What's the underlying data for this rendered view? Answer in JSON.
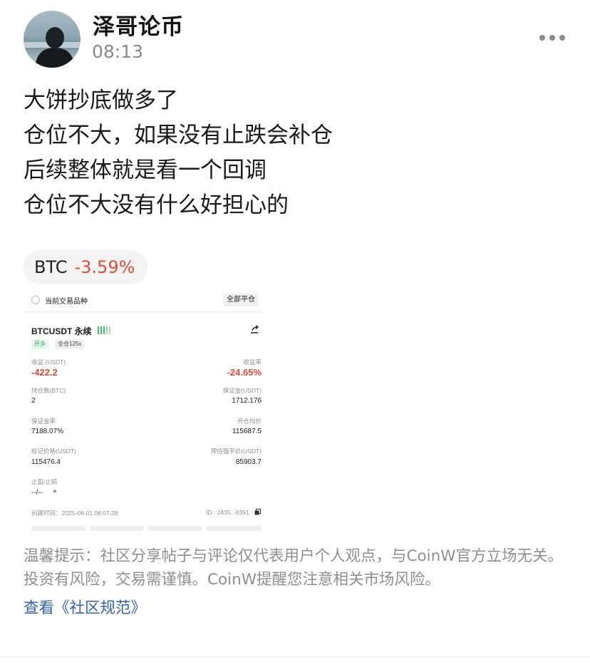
{
  "post": {
    "author": "泽哥论币",
    "time": "08:13",
    "lines": [
      "大饼抄底做多了",
      "仓位不大，如果没有止跌会补仓",
      "后续整体就是看一个回调",
      "仓位不大没有什么好担心的"
    ]
  },
  "ticker": {
    "symbol": "BTC",
    "change": "-3.59%",
    "change_color": "#e04f39"
  },
  "position_card": {
    "current_label": "当前交易品种",
    "close_all": "全部平仓",
    "pair": "BTCUSDT 永续",
    "side": "开多",
    "margin_mode": "全仓125x",
    "pnl_label": "收益 (USDT)",
    "pnl_value": "-422.2",
    "roi_label": "收益率",
    "roi_value": "-24.65%",
    "size_label": "持仓数(BTC)",
    "size_value": "2",
    "margin_label": "保证金(USDT)",
    "margin_value": "1712.176",
    "margin_ratio_label": "保证金率",
    "margin_ratio_value": "7188.07%",
    "entry_label": "开仓均价",
    "entry_value": "115687.5",
    "mark_label": "标记价格(USDT)",
    "mark_value": "115476.4",
    "liq_label": "预估强平价(USDT)",
    "liq_value": "85903.7",
    "tpsl_label": "止盈/止损",
    "tpsl_value": "--/--",
    "tpsl_add": "+",
    "created": "创建时间：2025-08-01 08:07:28",
    "id": "ID : 2435...6391"
  },
  "disclaimer": "温馨提示：社区分享帖子与评论仅代表用户个人观点，与CoinW官方立场无关。投资有风险，交易需谨慎。CoinW提醒您注意相关市场风险。",
  "community_link": "查看《社区规范》",
  "colors": {
    "negative": "#e2463a",
    "long": "#2fab5f",
    "link": "#2f5fb8",
    "muted": "#8f8f8f"
  },
  "icons": {
    "more": "more-horizontal-icon",
    "share": "share-icon",
    "copy": "copy-icon"
  }
}
